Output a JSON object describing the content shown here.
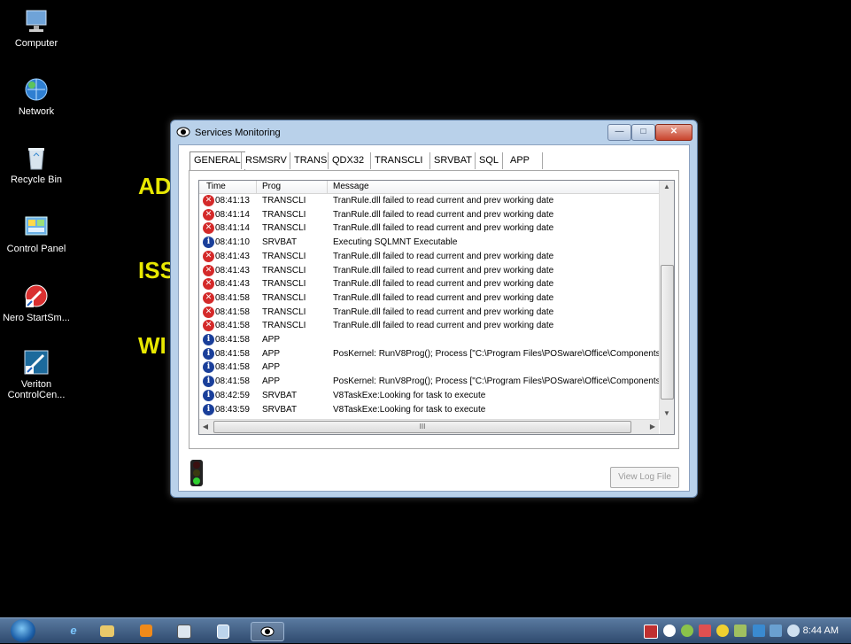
{
  "desktop": {
    "icons": [
      {
        "label": "Computer"
      },
      {
        "label": "Network"
      },
      {
        "label": "Recycle Bin"
      },
      {
        "label": "Control Panel"
      },
      {
        "label": "Nero StartSm..."
      },
      {
        "label": "Veriton ControlCen..."
      }
    ],
    "background_text": [
      "AD",
      "ISS",
      "WI"
    ]
  },
  "window": {
    "title": "Services Monitoring",
    "tabs": [
      "GENERAL",
      "RSMSRV",
      "TRANS",
      "QDX32",
      "TRANSCLI",
      "SRVBAT",
      "SQL",
      "APP"
    ],
    "active_tab": "GENERAL",
    "columns": [
      "Time",
      "Prog",
      "Message"
    ],
    "rows": [
      {
        "type": "error",
        "time": "08:41:13",
        "prog": "TRANSCLI",
        "message": "TranRule.dll failed to read current and prev working date"
      },
      {
        "type": "error",
        "time": "08:41:14",
        "prog": "TRANSCLI",
        "message": "TranRule.dll failed to read current and prev working date"
      },
      {
        "type": "error",
        "time": "08:41:14",
        "prog": "TRANSCLI",
        "message": "TranRule.dll failed to read current and prev working date"
      },
      {
        "type": "info",
        "time": "08:41:10",
        "prog": "SRVBAT",
        "message": "Executing SQLMNT Executable"
      },
      {
        "type": "error",
        "time": "08:41:43",
        "prog": "TRANSCLI",
        "message": "TranRule.dll failed to read current and prev working date"
      },
      {
        "type": "error",
        "time": "08:41:43",
        "prog": "TRANSCLI",
        "message": "TranRule.dll failed to read current and prev working date"
      },
      {
        "type": "error",
        "time": "08:41:43",
        "prog": "TRANSCLI",
        "message": "TranRule.dll failed to read current and prev working date"
      },
      {
        "type": "error",
        "time": "08:41:58",
        "prog": "TRANSCLI",
        "message": "TranRule.dll failed to read current and prev working date"
      },
      {
        "type": "error",
        "time": "08:41:58",
        "prog": "TRANSCLI",
        "message": "TranRule.dll failed to read current and prev working date"
      },
      {
        "type": "error",
        "time": "08:41:58",
        "prog": "TRANSCLI",
        "message": "TranRule.dll failed to read current and prev working date"
      },
      {
        "type": "info",
        "time": "08:41:58",
        "prog": "APP",
        "message": ""
      },
      {
        "type": "info",
        "time": "08:41:58",
        "prog": "APP",
        "message": "PosKernel: RunV8Prog(); Process [\"C:\\Program Files\\POSware\\Office\\Components"
      },
      {
        "type": "info",
        "time": "08:41:58",
        "prog": "APP",
        "message": ""
      },
      {
        "type": "info",
        "time": "08:41:58",
        "prog": "APP",
        "message": "PosKernel: RunV8Prog(); Process [\"C:\\Program Files\\POSware\\Office\\Components"
      },
      {
        "type": "info",
        "time": "08:42:59",
        "prog": "SRVBAT",
        "message": "V8TaskExe:Looking for task to execute"
      },
      {
        "type": "info",
        "time": "08:43:59",
        "prog": "SRVBAT",
        "message": "V8TaskExe:Looking for task to execute"
      }
    ],
    "view_log_label": "View Log File",
    "hscroll_grip": "III"
  },
  "taskbar": {
    "clock": "8:44 AM"
  },
  "colors": {
    "desktop_bg": "#000000",
    "error_icon": "#d42a2a",
    "info_icon": "#1a3f9a",
    "background_text": "#e8e800"
  }
}
